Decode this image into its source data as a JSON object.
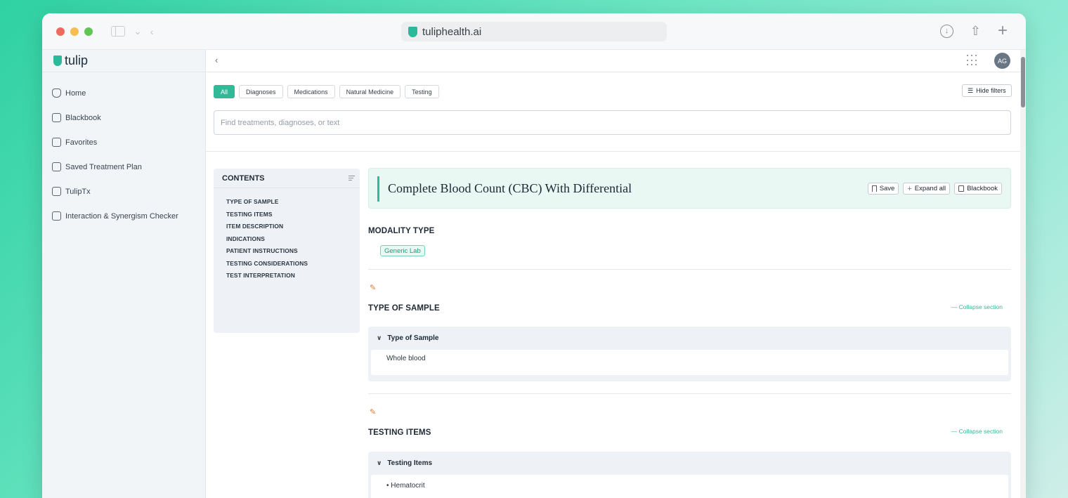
{
  "browser": {
    "url": "tuliphealth.ai"
  },
  "app": {
    "brand": "tulip",
    "avatar_initials": "AG"
  },
  "sidebar": {
    "items": [
      {
        "label": "Home",
        "icon": "home-icon"
      },
      {
        "label": "Blackbook",
        "icon": "book-icon"
      },
      {
        "label": "Favorites",
        "icon": "folder-icon"
      },
      {
        "label": "Saved Treatment Plan",
        "icon": "saved-plan-icon"
      },
      {
        "label": "TulipTx",
        "icon": "document-icon"
      },
      {
        "label": "Interaction & Synergism Checker",
        "icon": "checker-icon"
      }
    ]
  },
  "filters": {
    "chips": [
      "All",
      "Diagnoses",
      "Medications",
      "Natural Medicine",
      "Testing"
    ],
    "active": "All",
    "hide_label": "Hide filters"
  },
  "search": {
    "placeholder": "Find treatments, diagnoses, or text"
  },
  "toc": {
    "heading": "CONTENTS",
    "items": [
      "TYPE OF SAMPLE",
      "TESTING ITEMS",
      "ITEM DESCRIPTION",
      "INDICATIONS",
      "PATIENT INSTRUCTIONS",
      "TESTING CONSIDERATIONS",
      "TEST INTERPRETATION"
    ]
  },
  "document": {
    "title": "Complete Blood Count (CBC) With Differential",
    "actions": {
      "save": "Save",
      "expand_all": "Expand all",
      "blackbook": "Blackbook"
    },
    "modality": {
      "heading": "MODALITY TYPE",
      "badge": "Generic Lab"
    },
    "collapse_label": "Collapse section",
    "sections": [
      {
        "heading": "TYPE OF SAMPLE",
        "card_title": "Type of Sample",
        "body": "Whole blood"
      },
      {
        "heading": "TESTING ITEMS",
        "card_title": "Testing Items",
        "bullets": [
          "Hematocrit"
        ]
      }
    ]
  },
  "colors": {
    "accent": "#34b998",
    "sidebar_bg": "#f2f5f8",
    "title_card_bg": "#eaf8f4",
    "pencil": "#e07a2e"
  }
}
